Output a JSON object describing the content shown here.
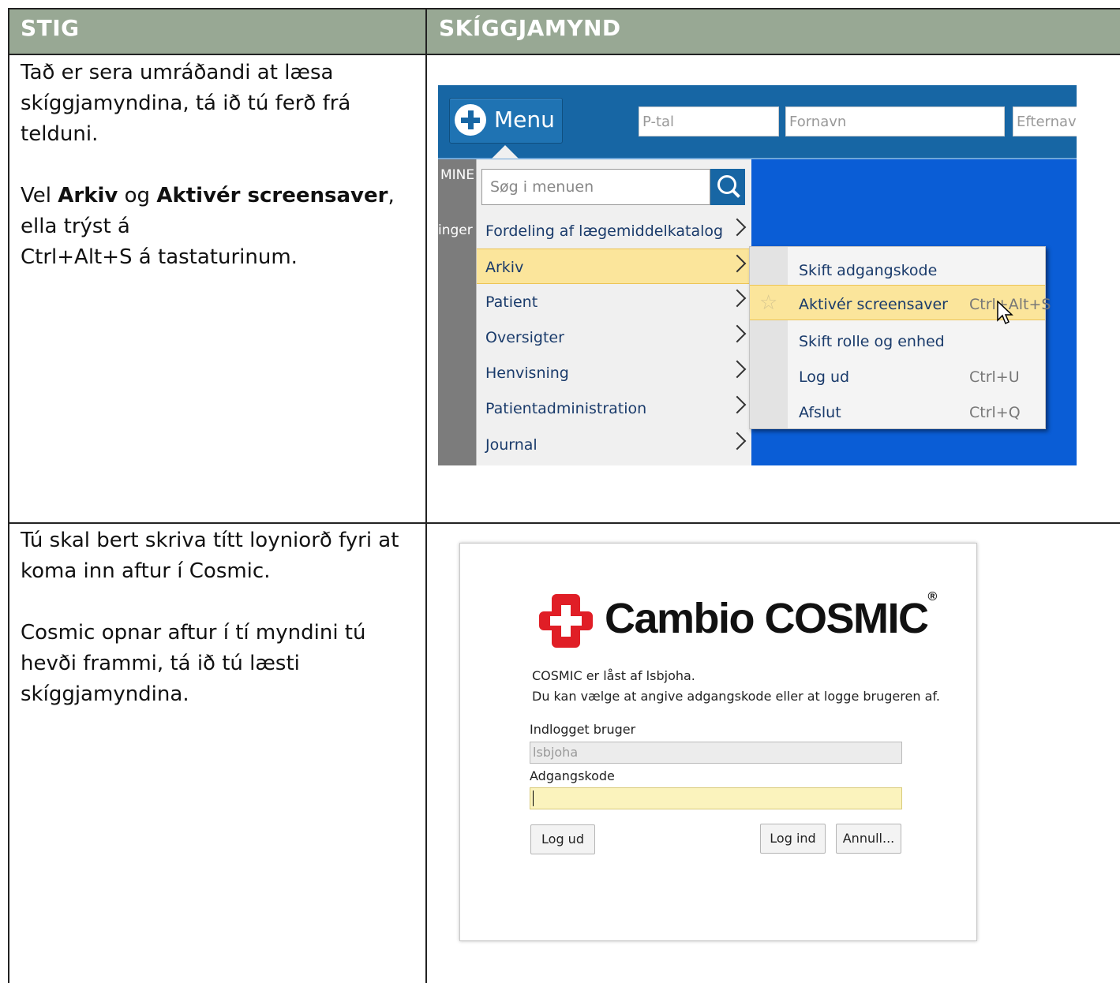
{
  "table": {
    "headers": [
      "STIG",
      "SKÍGGJAMYND"
    ],
    "row1": {
      "p1": "Tað er sera umráðandi at læsa skíggjamyndina, tá ið tú ferð frá telduni.",
      "p2_pre": "Vel ",
      "p2_b1": "Arkiv",
      "p2_mid": " og ",
      "p2_b2": "Aktivér screensaver",
      "p2_post": ", ella trýst á",
      "p3": "Ctrl+Alt+S á tastaturinum."
    },
    "row2": {
      "p1": "Tú skal bert skriva títt loyniorð fyri at koma inn aftur í Cosmic.",
      "p2": "Cosmic opnar aftur í tí myndini tú hevði frammi, tá ið tú læsti skíggjamyndina."
    }
  },
  "screenshot1": {
    "menu_button": "Menu",
    "fields": [
      "P-tal",
      "Fornavn",
      "Efternavn"
    ],
    "left_strip": [
      "MINE",
      "inger"
    ],
    "search_placeholder": "Søg i menuen",
    "menu_items": [
      {
        "label": "Fordeling af lægemiddelkatalog",
        "highlighted": false
      },
      {
        "label": "Arkiv",
        "highlighted": true
      },
      {
        "label": "Patient",
        "highlighted": false
      },
      {
        "label": "Oversigter",
        "highlighted": false
      },
      {
        "label": "Henvisning",
        "highlighted": false
      },
      {
        "label": "Patientadministration",
        "highlighted": false
      },
      {
        "label": "Journal",
        "highlighted": false
      }
    ],
    "submenu_items": [
      {
        "label": "Skift adgangskode",
        "shortcut": ""
      },
      {
        "label": "Aktivér screensaver",
        "shortcut": "Ctrl+Alt+S",
        "highlighted": true,
        "icon": "star-icon"
      },
      {
        "label": "Skift rolle og enhed",
        "shortcut": ""
      },
      {
        "label": "Log ud",
        "shortcut": "Ctrl+U"
      },
      {
        "label": "Afslut",
        "shortcut": "Ctrl+Q"
      }
    ]
  },
  "screenshot2": {
    "brand": "Cambio COSMIC",
    "brand_mark": "®",
    "message1": "COSMIC er låst af lsbjoha.",
    "message2": "Du kan vælge at angive adgangskode eller at logge brugeren af.",
    "user_label": "Indlogget bruger",
    "user_value": "lsbjoha",
    "password_label": "Adgangskode",
    "password_value": "",
    "btn_logout": "Log ud",
    "btn_login": "Log ind",
    "btn_cancel": "Annull..."
  },
  "colors": {
    "header_bg": "#98a894",
    "highlight": "#fbe59b",
    "app_blue": "#1766a4",
    "brand_red": "#e01e26"
  }
}
